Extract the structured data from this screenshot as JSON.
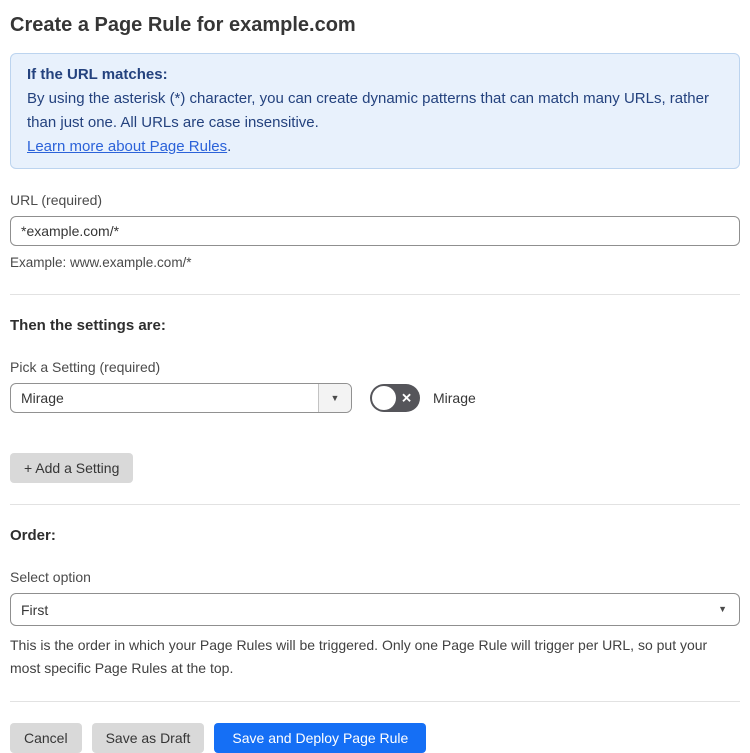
{
  "page": {
    "title": "Create a Page Rule for example.com"
  },
  "info_box": {
    "heading": "If the URL matches:",
    "body": "By using the asterisk (*) character, you can create dynamic patterns that can match many URLs, rather than just one. All URLs are case insensitive.",
    "link_text": "Learn more about Page Rules",
    "link_suffix": "."
  },
  "url_field": {
    "label": "URL (required)",
    "value": "*example.com/*",
    "helper": "Example: www.example.com/*"
  },
  "settings_section": {
    "heading": "Then the settings are:",
    "picker_label": "Pick a Setting (required)",
    "picker_value": "Mirage",
    "toggle_label": "Mirage",
    "toggle_state": "off",
    "add_setting_label": "+ Add a Setting"
  },
  "order_section": {
    "heading": "Order:",
    "select_label": "Select option",
    "select_value": "First",
    "helper": "This is the order in which your Page Rules will be triggered. Only one Page Rule will trigger per URL, so put your most specific Page Rules at the top."
  },
  "actions": {
    "cancel": "Cancel",
    "save_draft": "Save as Draft",
    "save_deploy": "Save and Deploy Page Rule"
  },
  "icons": {
    "chevron_down": "▼",
    "toggle_x": "✕"
  },
  "colors": {
    "info_bg": "#e8f1fc",
    "info_border": "#bcd4ef",
    "info_text": "#24427e",
    "link": "#2b62d9",
    "primary_button": "#156ff5",
    "gray_button": "#d9d9d9",
    "toggle_off": "#55555a",
    "divider": "#e2e2e2"
  }
}
